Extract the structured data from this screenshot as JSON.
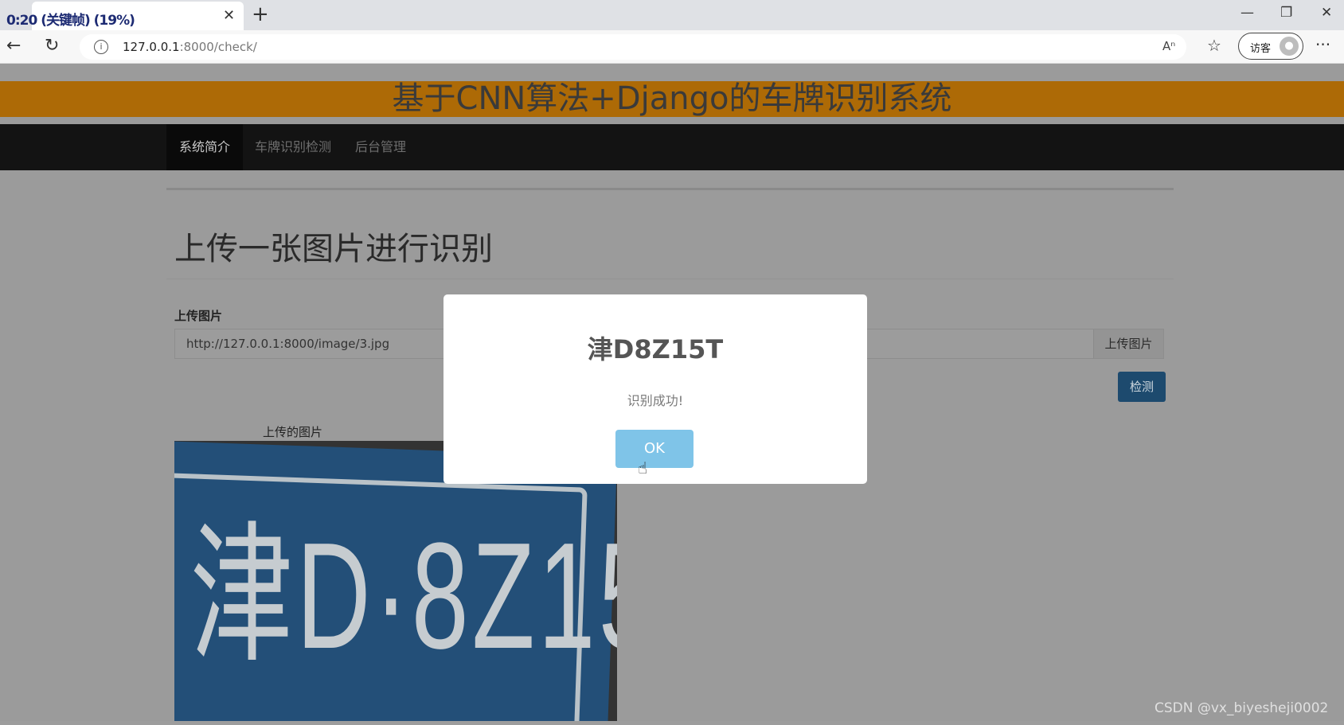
{
  "browser": {
    "tab_title": "0:20 (关键帧) (19%)",
    "tab_close": "✕",
    "new_tab": "+",
    "url_host": "127.0.0.1",
    "url_path": ":8000/check/",
    "profile_label": "访客",
    "window_controls": [
      "—",
      "❐",
      "✕"
    ]
  },
  "page": {
    "banner_title": "基于CNN算法+Django的车牌识别系统",
    "nav": [
      {
        "label": "系统简介",
        "active": true
      },
      {
        "label": "车牌识别检测",
        "active": false
      },
      {
        "label": "后台管理",
        "active": false
      }
    ],
    "heading": "上传一张图片进行识别",
    "field_label": "上传图片",
    "input_value": "http://127.0.0.1:8000/image/3.jpg",
    "upload_button": "上传图片",
    "detect_button": "检测",
    "image_caption": "上传的图片",
    "plate_text": "津D·8Z15T"
  },
  "modal": {
    "title": "津D8Z15T",
    "message": "识别成功!",
    "ok_label": "OK"
  },
  "watermark": "CSDN @vx_biyesheji0002",
  "colors": {
    "banner": "#ad6a06",
    "navbar": "#131313",
    "ok_button": "#7fc4e8",
    "detect_button": "#1d4a6e"
  }
}
